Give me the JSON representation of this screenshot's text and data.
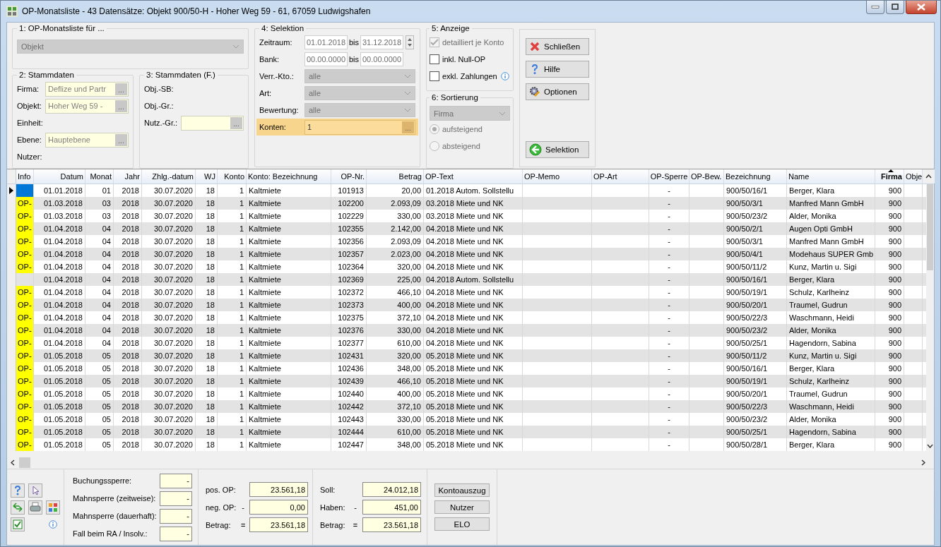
{
  "window": {
    "title": "OP-Monatsliste - 43 Datensätze:  Objekt 900/50-H - Hoher Weg 59 - 61, 67059 Ludwigshafen"
  },
  "group1": {
    "title": "1: OP-Monatsliste für ...",
    "select": "Objekt"
  },
  "group2": {
    "title": "2: Stammdaten",
    "items": [
      {
        "kind": "lookup",
        "label": "Firma:",
        "value": "Deflize und Partr",
        "browse": "..."
      },
      {
        "kind": "lookup",
        "label": "Objekt:",
        "value": "Hoher Weg 59 -",
        "browse": "..."
      },
      {
        "kind": "label",
        "label": "Einheit:"
      },
      {
        "kind": "lookup",
        "label": "Ebene:",
        "value": "Hauptebene",
        "browse": "..."
      },
      {
        "kind": "label",
        "label": "Nutzer:"
      }
    ]
  },
  "group3": {
    "title": "3: Stammdaten (F.)",
    "items": [
      {
        "kind": "label",
        "label": "Obj.-SB:"
      },
      {
        "kind": "label",
        "label": "Obj.-Gr.:"
      },
      {
        "kind": "lookup",
        "label": "Nutz.-Gr.:",
        "browse": "..."
      }
    ]
  },
  "group4": {
    "title": "4: Selektion",
    "items": [
      {
        "kind": "range",
        "label": "Zeitraum:",
        "from": "01.01.2018",
        "sep": "bis",
        "to": "31.12.2018"
      },
      {
        "kind": "range",
        "label": "Bank:",
        "from": "00.00.0000",
        "sep": "bis",
        "to": "00.00.0000"
      },
      {
        "kind": "select",
        "label": "Verr.-Kto.:",
        "value": "alle"
      },
      {
        "kind": "select",
        "label": "Art:",
        "value": "alle"
      },
      {
        "kind": "select",
        "label": "Bewertung:",
        "value": "alle"
      },
      {
        "kind": "lookup",
        "label": "Konten:",
        "value": "1",
        "browse": "...",
        "highlighted": true
      }
    ]
  },
  "group5": {
    "title": "5: Anzeige",
    "checkboxes": [
      {
        "label": "detailliert je Konto",
        "checked": true,
        "disabled": true
      },
      {
        "label": "inkl. Null-OP",
        "checked": false,
        "disabled": false
      },
      {
        "label": "exkl. Zahlungen",
        "checked": false,
        "disabled": false,
        "info": true
      }
    ]
  },
  "group6": {
    "title": "6: Sortierung",
    "select": "Firma",
    "disabled": true,
    "radios": [
      {
        "label": "aufsteigend",
        "selected": true
      },
      {
        "label": "absteigend",
        "selected": false
      }
    ]
  },
  "actions": [
    {
      "label": "Schließen",
      "kind": "close"
    },
    {
      "label": "Hilfe",
      "kind": "help"
    },
    {
      "label": "Optionen",
      "kind": "options"
    },
    {
      "label": "Selektion",
      "kind": "back"
    }
  ],
  "table": {
    "columns": [
      {
        "label": "Info",
        "sorted": false
      },
      {
        "label": "Datum",
        "sorted": false
      },
      {
        "label": "Monat",
        "sorted": false
      },
      {
        "label": "Jahr",
        "sorted": false
      },
      {
        "label": "Zhlg.-datum",
        "sorted": false
      },
      {
        "label": "WJ",
        "sorted": false
      },
      {
        "label": "Konto",
        "sorted": false
      },
      {
        "label": "Konto: Bezeichnung",
        "sorted": false
      },
      {
        "label": "OP-Nr.",
        "sorted": false
      },
      {
        "label": "Betrag",
        "sorted": false
      },
      {
        "label": "OP-Text",
        "sorted": false
      },
      {
        "label": "OP-Memo",
        "sorted": false
      },
      {
        "label": "OP-Art",
        "sorted": false
      },
      {
        "label": "OP-Sperre",
        "sorted": false
      },
      {
        "label": "OP-Bew.",
        "sorted": false
      },
      {
        "label": "Bezeichnung",
        "sorted": false
      },
      {
        "label": "Name",
        "sorted": false
      },
      {
        "label": "Firma",
        "sorted": true
      },
      {
        "label": "Obje",
        "sorted": false
      }
    ],
    "rows": [
      {
        "current": true,
        "datum": "01.01.2018",
        "monat": "01",
        "jahr": "2018",
        "zhlg": "30.07.2020",
        "wj": "18",
        "konto": "1",
        "bez": "Kaltmiete",
        "nr": "101913",
        "betrag": "20,00",
        "text": "01.2018 Autom. Sollstellu",
        "sperre": "-",
        "bezeichnung": "900/50/16/1",
        "name": "Berger, Klara",
        "firma": "900"
      },
      {
        "info": "OP-",
        "datum": "01.03.2018",
        "monat": "03",
        "jahr": "2018",
        "zhlg": "30.07.2020",
        "wj": "18",
        "konto": "1",
        "bez": "Kaltmiete",
        "nr": "102200",
        "betrag": "2.093,09",
        "text": "03.2018 Miete und NK",
        "sperre": "-",
        "bezeichnung": "900/50/3/1",
        "name": "Manfred Mann GmbH",
        "firma": "900"
      },
      {
        "info": "OP-",
        "datum": "01.03.2018",
        "monat": "03",
        "jahr": "2018",
        "zhlg": "30.07.2020",
        "wj": "18",
        "konto": "1",
        "bez": "Kaltmiete",
        "nr": "102229",
        "betrag": "330,00",
        "text": "03.2018 Miete und NK",
        "sperre": "-",
        "bezeichnung": "900/50/23/2",
        "name": "Alder, Monika",
        "firma": "900"
      },
      {
        "info": "OP-",
        "datum": "01.04.2018",
        "monat": "04",
        "jahr": "2018",
        "zhlg": "30.07.2020",
        "wj": "18",
        "konto": "1",
        "bez": "Kaltmiete",
        "nr": "102355",
        "betrag": "2.142,00",
        "text": "04.2018 Miete und NK",
        "sperre": "-",
        "bezeichnung": "900/50/2/1",
        "name": "Augen Opti GmbH",
        "firma": "900"
      },
      {
        "info": "OP-",
        "datum": "01.04.2018",
        "monat": "04",
        "jahr": "2018",
        "zhlg": "30.07.2020",
        "wj": "18",
        "konto": "1",
        "bez": "Kaltmiete",
        "nr": "102356",
        "betrag": "2.093,09",
        "text": "04.2018 Miete und NK",
        "sperre": "-",
        "bezeichnung": "900/50/3/1",
        "name": "Manfred Mann GmbH",
        "firma": "900"
      },
      {
        "info": "OP-",
        "datum": "01.04.2018",
        "monat": "04",
        "jahr": "2018",
        "zhlg": "30.07.2020",
        "wj": "18",
        "konto": "1",
        "bez": "Kaltmiete",
        "nr": "102357",
        "betrag": "2.023,00",
        "text": "04.2018 Miete und NK",
        "sperre": "-",
        "bezeichnung": "900/50/4/1",
        "name": "Modehaus SUPER Gmb",
        "firma": "900"
      },
      {
        "info": "OP-",
        "datum": "01.04.2018",
        "monat": "04",
        "jahr": "2018",
        "zhlg": "30.07.2020",
        "wj": "18",
        "konto": "1",
        "bez": "Kaltmiete",
        "nr": "102364",
        "betrag": "320,00",
        "text": "04.2018 Miete und NK",
        "sperre": "-",
        "bezeichnung": "900/50/11/2",
        "name": "Kunz, Martin u. Sigi",
        "firma": "900"
      },
      {
        "datum": "01.04.2018",
        "monat": "04",
        "jahr": "2018",
        "zhlg": "30.07.2020",
        "wj": "18",
        "konto": "1",
        "bez": "Kaltmiete",
        "nr": "102369",
        "betrag": "225,00",
        "text": "04.2018 Autom. Sollstellu",
        "sperre": "-",
        "bezeichnung": "900/50/16/1",
        "name": "Berger, Klara",
        "firma": "900"
      },
      {
        "info": "OP-",
        "datum": "01.04.2018",
        "monat": "04",
        "jahr": "2018",
        "zhlg": "30.07.2020",
        "wj": "18",
        "konto": "1",
        "bez": "Kaltmiete",
        "nr": "102372",
        "betrag": "466,10",
        "text": "04.2018 Miete und NK",
        "sperre": "-",
        "bezeichnung": "900/50/19/1",
        "name": "Schulz, Karlheinz",
        "firma": "900"
      },
      {
        "info": "OP-",
        "datum": "01.04.2018",
        "monat": "04",
        "jahr": "2018",
        "zhlg": "30.07.2020",
        "wj": "18",
        "konto": "1",
        "bez": "Kaltmiete",
        "nr": "102373",
        "betrag": "400,00",
        "text": "04.2018 Miete und NK",
        "sperre": "-",
        "bezeichnung": "900/50/20/1",
        "name": "Traumel, Gudrun",
        "firma": "900"
      },
      {
        "info": "OP-",
        "datum": "01.04.2018",
        "monat": "04",
        "jahr": "2018",
        "zhlg": "30.07.2020",
        "wj": "18",
        "konto": "1",
        "bez": "Kaltmiete",
        "nr": "102375",
        "betrag": "372,10",
        "text": "04.2018 Miete und NK",
        "sperre": "-",
        "bezeichnung": "900/50/22/3",
        "name": "Waschmann, Heidi",
        "firma": "900"
      },
      {
        "info": "OP-",
        "datum": "01.04.2018",
        "monat": "04",
        "jahr": "2018",
        "zhlg": "30.07.2020",
        "wj": "18",
        "konto": "1",
        "bez": "Kaltmiete",
        "nr": "102376",
        "betrag": "330,00",
        "text": "04.2018 Miete und NK",
        "sperre": "-",
        "bezeichnung": "900/50/23/2",
        "name": "Alder, Monika",
        "firma": "900"
      },
      {
        "info": "OP-",
        "datum": "01.04.2018",
        "monat": "04",
        "jahr": "2018",
        "zhlg": "30.07.2020",
        "wj": "18",
        "konto": "1",
        "bez": "Kaltmiete",
        "nr": "102377",
        "betrag": "610,00",
        "text": "04.2018 Miete und NK",
        "sperre": "-",
        "bezeichnung": "900/50/25/1",
        "name": "Hagendorn, Sabina",
        "firma": "900"
      },
      {
        "info": "OP-",
        "datum": "01.05.2018",
        "monat": "05",
        "jahr": "2018",
        "zhlg": "30.07.2020",
        "wj": "18",
        "konto": "1",
        "bez": "Kaltmiete",
        "nr": "102431",
        "betrag": "320,00",
        "text": "05.2018 Miete und NK",
        "sperre": "-",
        "bezeichnung": "900/50/11/2",
        "name": "Kunz, Martin u. Sigi",
        "firma": "900"
      },
      {
        "info": "OP-",
        "datum": "01.05.2018",
        "monat": "05",
        "jahr": "2018",
        "zhlg": "30.07.2020",
        "wj": "18",
        "konto": "1",
        "bez": "Kaltmiete",
        "nr": "102436",
        "betrag": "348,00",
        "text": "05.2018 Miete und NK",
        "sperre": "-",
        "bezeichnung": "900/50/16/1",
        "name": "Berger, Klara",
        "firma": "900"
      },
      {
        "info": "OP-",
        "datum": "01.05.2018",
        "monat": "05",
        "jahr": "2018",
        "zhlg": "30.07.2020",
        "wj": "18",
        "konto": "1",
        "bez": "Kaltmiete",
        "nr": "102439",
        "betrag": "466,10",
        "text": "05.2018 Miete und NK",
        "sperre": "-",
        "bezeichnung": "900/50/19/1",
        "name": "Schulz, Karlheinz",
        "firma": "900"
      },
      {
        "info": "OP-",
        "datum": "01.05.2018",
        "monat": "05",
        "jahr": "2018",
        "zhlg": "30.07.2020",
        "wj": "18",
        "konto": "1",
        "bez": "Kaltmiete",
        "nr": "102440",
        "betrag": "400,00",
        "text": "05.2018 Miete und NK",
        "sperre": "-",
        "bezeichnung": "900/50/20/1",
        "name": "Traumel, Gudrun",
        "firma": "900"
      },
      {
        "info": "OP-",
        "datum": "01.05.2018",
        "monat": "05",
        "jahr": "2018",
        "zhlg": "30.07.2020",
        "wj": "18",
        "konto": "1",
        "bez": "Kaltmiete",
        "nr": "102442",
        "betrag": "372,10",
        "text": "05.2018 Miete und NK",
        "sperre": "-",
        "bezeichnung": "900/50/22/3",
        "name": "Waschmann, Heidi",
        "firma": "900"
      },
      {
        "info": "OP-",
        "datum": "01.05.2018",
        "monat": "05",
        "jahr": "2018",
        "zhlg": "30.07.2020",
        "wj": "18",
        "konto": "1",
        "bez": "Kaltmiete",
        "nr": "102443",
        "betrag": "330,00",
        "text": "05.2018 Miete und NK",
        "sperre": "-",
        "bezeichnung": "900/50/23/2",
        "name": "Alder, Monika",
        "firma": "900"
      },
      {
        "info": "OP-",
        "datum": "01.05.2018",
        "monat": "05",
        "jahr": "2018",
        "zhlg": "30.07.2020",
        "wj": "18",
        "konto": "1",
        "bez": "Kaltmiete",
        "nr": "102444",
        "betrag": "610,00",
        "text": "05.2018 Miete und NK",
        "sperre": "-",
        "bezeichnung": "900/50/25/1",
        "name": "Hagendorn, Sabina",
        "firma": "900"
      },
      {
        "info": "OP-",
        "datum": "01.05.2018",
        "monat": "05",
        "jahr": "2018",
        "zhlg": "30.07.2020",
        "wj": "18",
        "konto": "1",
        "bez": "Kaltmiete",
        "nr": "102447",
        "betrag": "348,00",
        "text": "05.2018 Miete und NK",
        "sperre": "-",
        "bezeichnung": "900/50/28/1",
        "name": "Berger, Klara",
        "firma": "900"
      }
    ]
  },
  "locks": [
    {
      "label": "Buchungssperre:",
      "value": "-"
    },
    {
      "label": "Mahnsperre (zeitweise):",
      "value": "-"
    },
    {
      "label": "Mahnsperre (dauerhaft):",
      "value": "-"
    },
    {
      "label": "Fall beim RA / Insolv.:",
      "value": "-"
    }
  ],
  "op_sums": [
    {
      "label": "pos. OP:",
      "value": "23.561,18"
    },
    {
      "label": "neg. OP:",
      "op": "-",
      "value": "0,00"
    },
    {
      "label": "Betrag:",
      "op": "=",
      "value": "23.561,18"
    }
  ],
  "balance": [
    {
      "label": "Soll:",
      "value": "24.012,18"
    },
    {
      "label": "Haben:",
      "op": "-",
      "value": "451,00"
    },
    {
      "label": "Betrag:",
      "op": "=",
      "value": "23.561,18"
    }
  ],
  "bottom_buttons": [
    "Kontoauszug",
    "Nutzer",
    "ELO"
  ]
}
